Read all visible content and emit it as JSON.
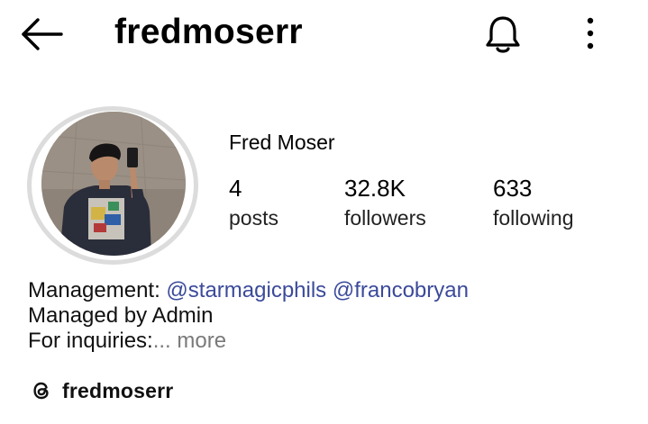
{
  "header": {
    "username": "fredmoserr",
    "back_icon": "arrow-left-icon",
    "bell_icon": "bell-icon",
    "more_icon": "more-vertical-icon"
  },
  "profile": {
    "display_name": "Fred Moser",
    "avatar_icon": "profile-photo",
    "stats": [
      {
        "value": "4",
        "label": "posts"
      },
      {
        "value": "32.8K",
        "label": "followers"
      },
      {
        "value": "633",
        "label": "following"
      }
    ]
  },
  "bio": {
    "management_prefix": "Management: ",
    "mention1": "@starmagicphils",
    "mention2": "@francobryan",
    "line2": "Managed by Admin",
    "line3": "For inquiries:",
    "more": "... more"
  },
  "threads": {
    "icon": "threads-icon",
    "label": "fredmoserr"
  },
  "colors": {
    "mention": "#3b4a9a",
    "muted": "#7a7a7a",
    "ring": "#dcdcdc"
  }
}
